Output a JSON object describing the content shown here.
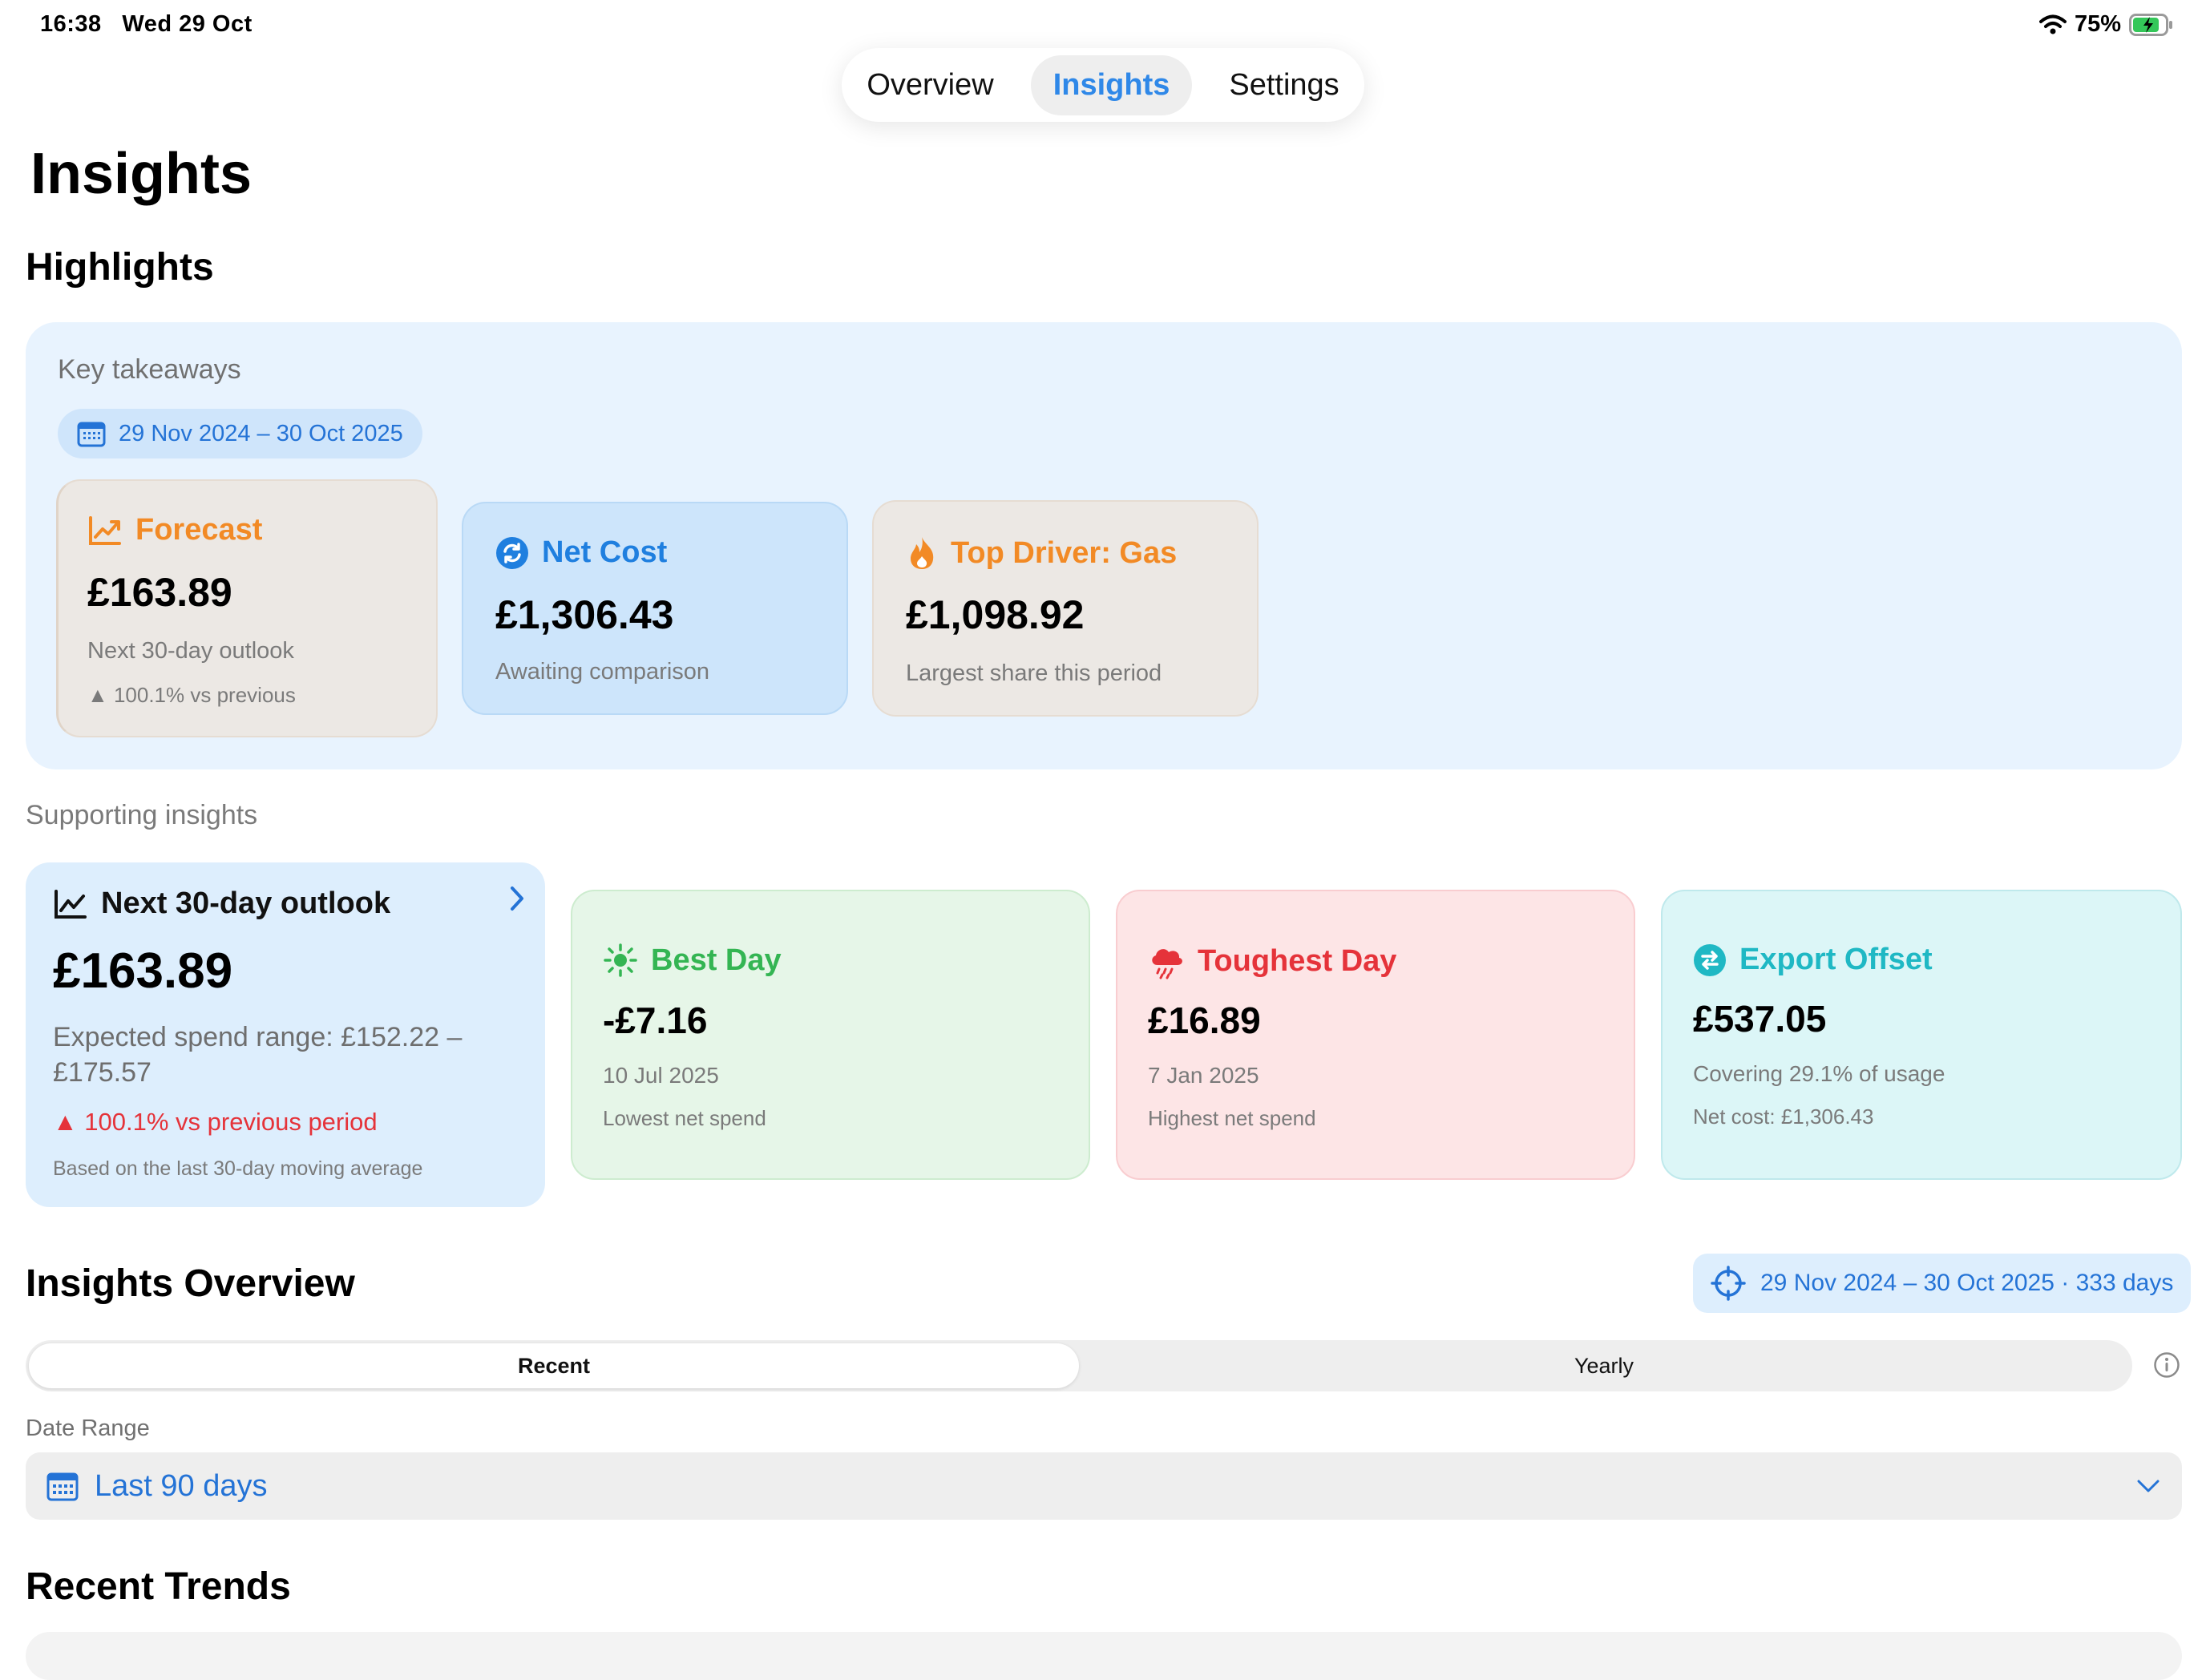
{
  "status_bar": {
    "time": "16:38",
    "date": "Wed 29 Oct",
    "battery": "75%",
    "icons": [
      "wifi-icon",
      "battery-charging-icon"
    ]
  },
  "nav": {
    "tabs": [
      "Overview",
      "Insights",
      "Settings"
    ],
    "active": "Insights"
  },
  "page_title": "Insights",
  "highlights": {
    "heading": "Highlights",
    "caption": "Key takeaways",
    "date_range": "29 Nov 2024 – 30 Oct 2025",
    "cards": {
      "forecast": {
        "title": "Forecast",
        "value": "£163.89",
        "sub": "Next 30-day outlook",
        "change": "▲ 100.1% vs previous",
        "color": "#f28a25",
        "icon": "trend-up-icon"
      },
      "net_cost": {
        "title": "Net Cost",
        "value": "£1,306.43",
        "sub": "Awaiting comparison",
        "color": "#1f7fdf",
        "icon": "refresh-circle-icon"
      },
      "top_driver": {
        "title": "Top Driver: Gas",
        "value": "£1,098.92",
        "sub": "Largest share this period",
        "color": "#f28a25",
        "icon": "flame-icon"
      }
    }
  },
  "supporting": {
    "caption": "Supporting insights",
    "outlook": {
      "title": "Next 30-day outlook",
      "value": "£163.89",
      "range": "Expected spend range: £152.22 – £175.57",
      "change": "▲ 100.1% vs previous period",
      "note": "Based on the last 30-day moving average",
      "change_color": "#e5333a"
    },
    "best_day": {
      "title": "Best Day",
      "value": "-£7.16",
      "date": "10 Jul 2025",
      "sub": "Lowest net spend",
      "color": "#34b553"
    },
    "toughest_day": {
      "title": "Toughest Day",
      "value": "£16.89",
      "date": "7 Jan 2025",
      "sub": "Highest net spend",
      "color": "#e5333a"
    },
    "export_offset": {
      "title": "Export Offset",
      "value": "£537.05",
      "sub": "Covering 29.1% of usage",
      "note": "Net cost: £1,306.43",
      "color": "#1fb8c4"
    }
  },
  "overview": {
    "heading": "Insights Overview",
    "range_chip": "29 Nov 2024 – 30 Oct 2025 · 333 days",
    "segments": [
      "Recent",
      "Yearly"
    ],
    "selected_segment": "Recent",
    "date_range_label": "Date Range",
    "date_range_value": "Last 90 days"
  },
  "recent_trends": {
    "heading": "Recent Trends"
  },
  "accent": "#2f88e8"
}
